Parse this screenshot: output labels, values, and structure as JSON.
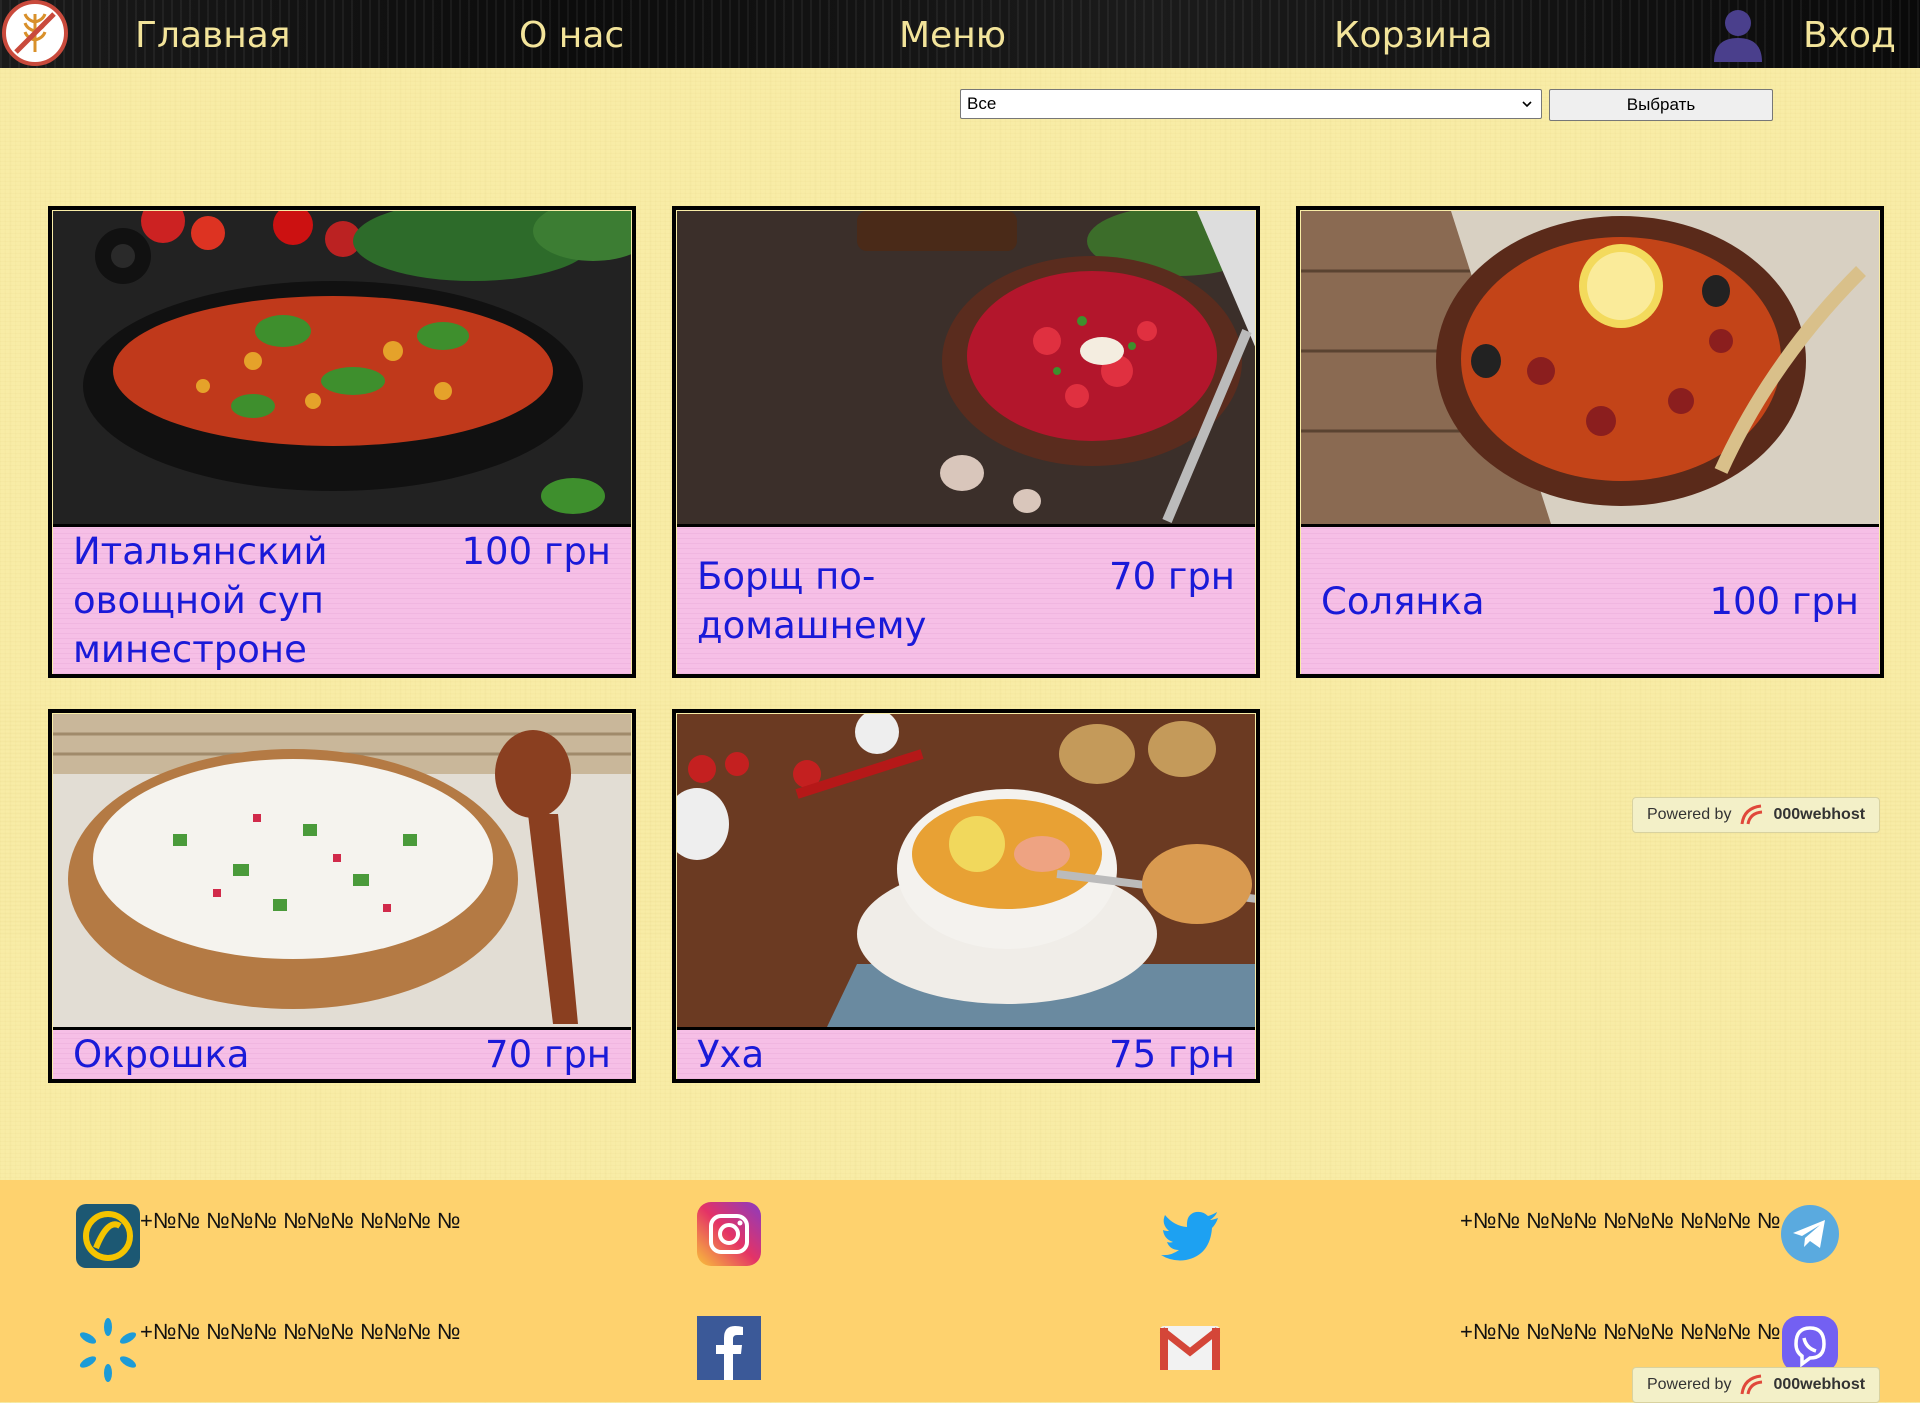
{
  "nav": {
    "logo_icon": "no-wheat-logo-icon",
    "links": [
      "Главная",
      "О нас",
      "Меню",
      "Корзина"
    ],
    "user_icon": "user-icon",
    "login": "Вход",
    "text_color": "#f3e49a"
  },
  "filter": {
    "selected": "Все",
    "button": "Выбрать"
  },
  "menu": {
    "items": [
      {
        "name": "Итальянский овощной суп минестроне",
        "price": "100 грн",
        "image": "minestrone-soup"
      },
      {
        "name": "Борщ по-домашнему",
        "price": "70 грн",
        "image": "borscht"
      },
      {
        "name": "Солянка",
        "price": "100 грн",
        "image": "solyanka"
      },
      {
        "name": "Окрошка",
        "price": "70 грн",
        "image": "okroshka"
      },
      {
        "name": "Уха",
        "price": "75 грн",
        "image": "ukha"
      }
    ],
    "text_color": "#1a1ad8",
    "info_bg": "#f6bfe6"
  },
  "footer": {
    "phones": [
      "+№№ №№№ №№№ №№№ №",
      "+№№ №№№ №№№ №№№ №",
      "+№№ №№№ №№№ №№№ №",
      "+№№ №№№ №№№ №№№ №"
    ],
    "icons": [
      "lifecell-icon",
      "kyivstar-icon",
      "instagram-icon",
      "facebook-icon",
      "twitter-icon",
      "gmail-icon",
      "telegram-icon",
      "viber-icon"
    ],
    "bg": "#fed26e"
  },
  "powered": {
    "label": "Powered by",
    "brand": "000webhost"
  }
}
